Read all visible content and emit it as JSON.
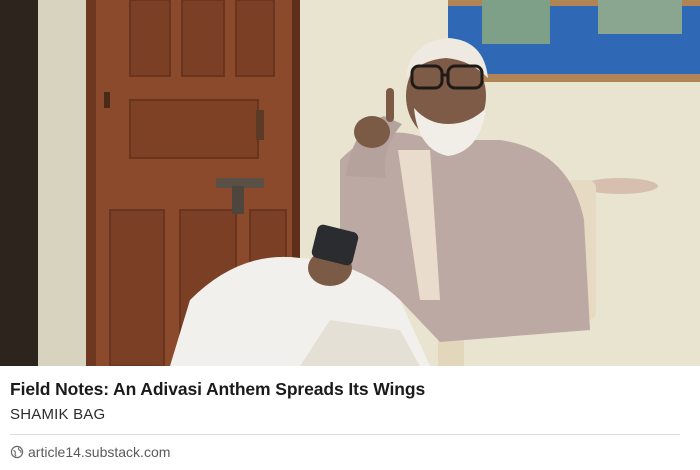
{
  "link_card": {
    "image_alt": "Elderly man with white beard and glasses seated in a plastic chair beside a wooden door, holding a phone and raising one finger",
    "title": "Field Notes: An Adivasi Anthem Spreads Its Wings",
    "author": "SHAMIK BAG",
    "domain": "article14.substack.com",
    "domain_icon": "globe-icon"
  }
}
